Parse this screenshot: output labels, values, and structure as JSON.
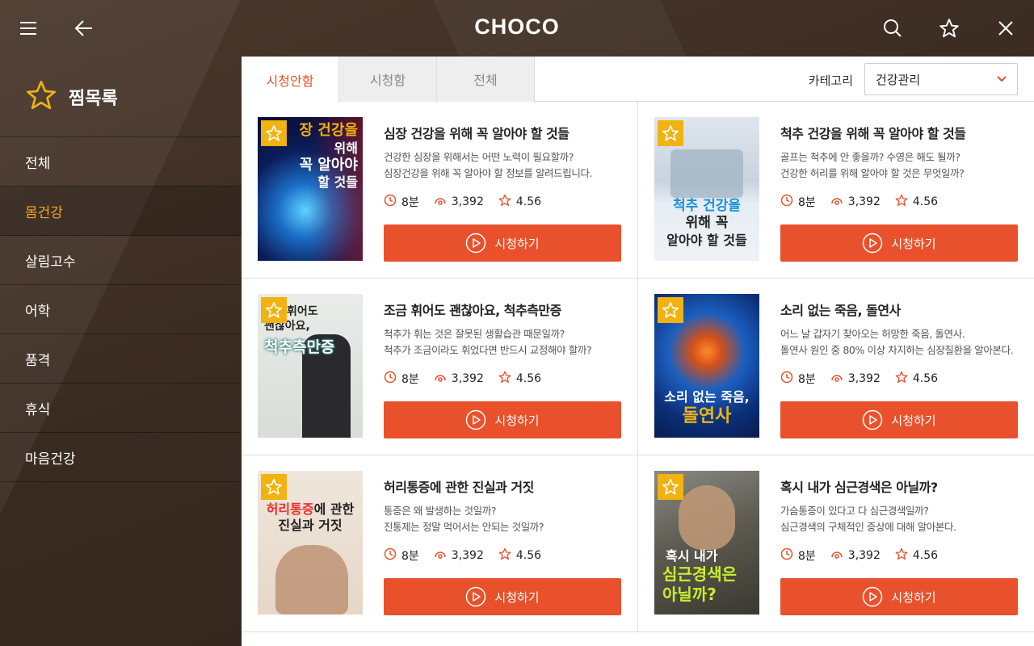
{
  "app": {
    "logo": "CHOCO"
  },
  "sidebar": {
    "title": "찜목록",
    "items": [
      {
        "label": "전체"
      },
      {
        "label": "몸건강",
        "active": true
      },
      {
        "label": "살림고수"
      },
      {
        "label": "어학"
      },
      {
        "label": "품격"
      },
      {
        "label": "휴식"
      },
      {
        "label": "마음건강"
      }
    ]
  },
  "tabs": [
    {
      "label": "시청안함",
      "active": true
    },
    {
      "label": "시청함"
    },
    {
      "label": "전체"
    }
  ],
  "category": {
    "label": "카테고리",
    "selected": "건강관리"
  },
  "colors": {
    "accent": "#e8512c",
    "active_menu": "#f5a623",
    "favorite": "#f2b20f"
  },
  "cards": [
    {
      "title": "심장 건강을 위해 꼭 알아야 할 것들",
      "desc1": "건강한 심장을 위해서는 어떤 노력이 필요할까?",
      "desc2": "심장건강을 위해 꼭 알아야 할 정보를 알려드립니다.",
      "duration": "8분",
      "views": "3,392",
      "rating": "4.56",
      "play_label": "시청하기",
      "cover": {
        "line1": "장 건강을",
        "line2": "위해",
        "line3": "꼭 알아야",
        "line4": "할 것들"
      }
    },
    {
      "title": "척추 건강을 위해 꼭 알아야 할 것들",
      "desc1": "골프는 척추에 안 좋을까? 수영은 해도 될까?",
      "desc2": "건강한 허리를 위해 알아야 할 것은 무엇일까?",
      "duration": "8분",
      "views": "3,392",
      "rating": "4.56",
      "play_label": "시청하기",
      "cover": {
        "line1": "척추 건강을",
        "line2": "위해 꼭",
        "line3": "알아야 할 것들"
      }
    },
    {
      "title": "조금 휘어도 괜찮아요, 척추측만증",
      "desc1": "척추가 휘는 것은 잘못된 생활습관 때문일까?",
      "desc2": "척추가 조금이라도 휘었다면 반드시 교정해야 할까?",
      "duration": "8분",
      "views": "3,392",
      "rating": "4.56",
      "play_label": "시청하기",
      "cover": {
        "line1": "휘어도",
        "line2": "괜찮아요,",
        "line3": "척추측만증"
      }
    },
    {
      "title": "소리 없는 죽음, 돌연사",
      "desc1": "어느 날 갑자기 찾아오는 허망한 죽음, 돌연사.",
      "desc2": "돌연사 원인 중 80% 이상 차지하는 심장질환을 알아본다.",
      "duration": "8분",
      "views": "3,392",
      "rating": "4.56",
      "play_label": "시청하기",
      "cover": {
        "line1": "소리 없는 죽음,",
        "line2": "돌연사"
      }
    },
    {
      "title": "허리통증에 관한 진실과 거짓",
      "desc1": "통증은 왜 발생하는 것일까?",
      "desc2": "진통제는 정말 먹어서는 안되는 것일까?",
      "duration": "8분",
      "views": "3,392",
      "rating": "4.56",
      "play_label": "시청하기",
      "cover": {
        "line1a": "허리통증",
        "line1b": "에 관한",
        "line2": "진실과 거짓"
      }
    },
    {
      "title": "혹시 내가 심근경색은 아닐까?",
      "desc1": "가슴통증이 있다고 다 심근경색일까?",
      "desc2": "심근경색의 구체적인 증상에 대해 알아본다.",
      "duration": "8분",
      "views": "3,392",
      "rating": "4.56",
      "play_label": "시청하기",
      "cover": {
        "line1": "혹시 내가",
        "line2": "심근경색은",
        "line3": "아닐까?"
      }
    }
  ]
}
